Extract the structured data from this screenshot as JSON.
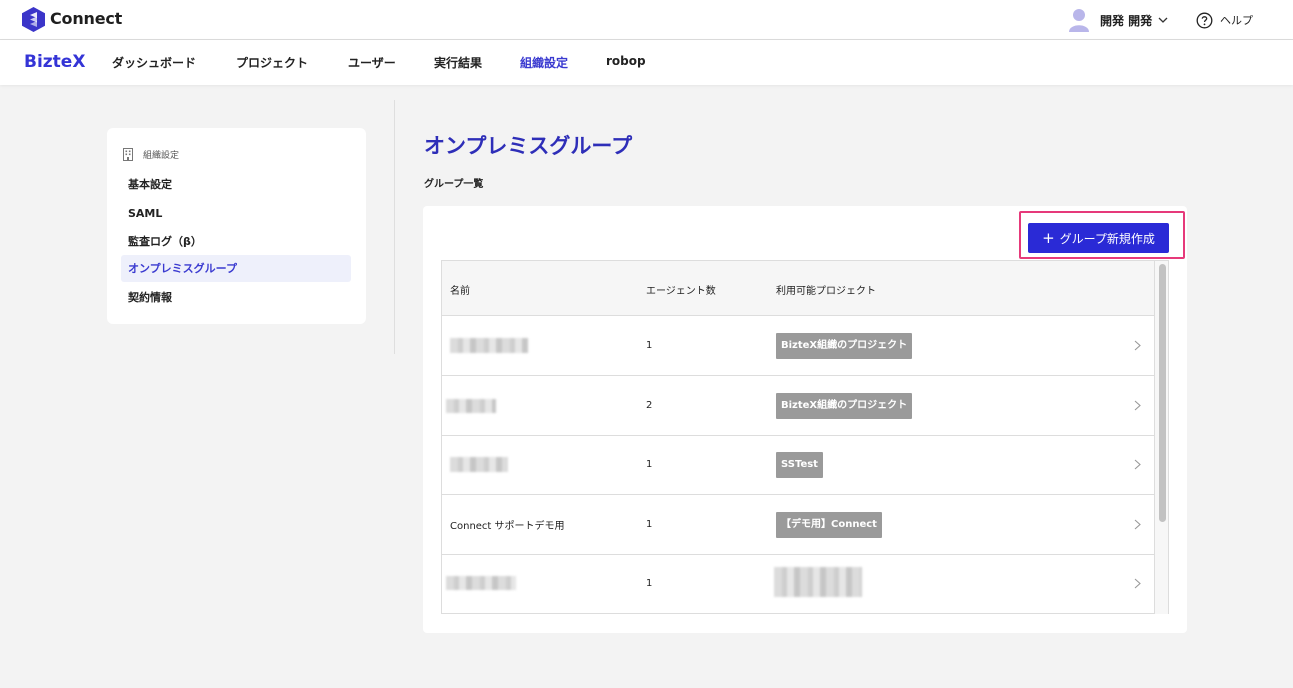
{
  "app": {
    "name": "Connect"
  },
  "user": {
    "name": "開発 開発"
  },
  "help": {
    "label": "ヘルプ"
  },
  "nav": {
    "brand": "BizteX",
    "items": [
      {
        "label": "ダッシュボード"
      },
      {
        "label": "プロジェクト"
      },
      {
        "label": "ユーザー"
      },
      {
        "label": "実行結果"
      },
      {
        "label": "組織設定",
        "active": true
      },
      {
        "label": "robop"
      }
    ]
  },
  "sidebar": {
    "heading": "組織設定",
    "items": [
      {
        "label": "基本設定"
      },
      {
        "label": "SAML"
      },
      {
        "label": "監査ログ（β）"
      },
      {
        "label": "オンプレミスグループ",
        "active": true
      },
      {
        "label": "契約情報"
      }
    ]
  },
  "main": {
    "title": "オンプレミスグループ",
    "subtitle": "グループ一覧",
    "new_button_label": "グループ新規作成",
    "table": {
      "columns": [
        "名前",
        "エージェント数",
        "利用可能プロジェクト"
      ],
      "rows": [
        {
          "name": "",
          "name_redacted": true,
          "agents": "1",
          "project": "BizteX組織のプロジェクト"
        },
        {
          "name": "",
          "name_redacted": true,
          "agents": "2",
          "project": "BizteX組織のプロジェクト"
        },
        {
          "name": "",
          "name_redacted": true,
          "agents": "1",
          "project": "SSTest"
        },
        {
          "name": "Connect サポートデモ用",
          "name_redacted": false,
          "agents": "1",
          "project": "【デモ用】Connect"
        },
        {
          "name": "",
          "name_redacted": true,
          "agents": "1",
          "project": "",
          "project_redacted": true
        }
      ]
    }
  },
  "colors": {
    "accent": "#2a2ad6",
    "brand": "#3434d6",
    "highlight": "#e6397a",
    "tag": "#9a9a9a"
  }
}
